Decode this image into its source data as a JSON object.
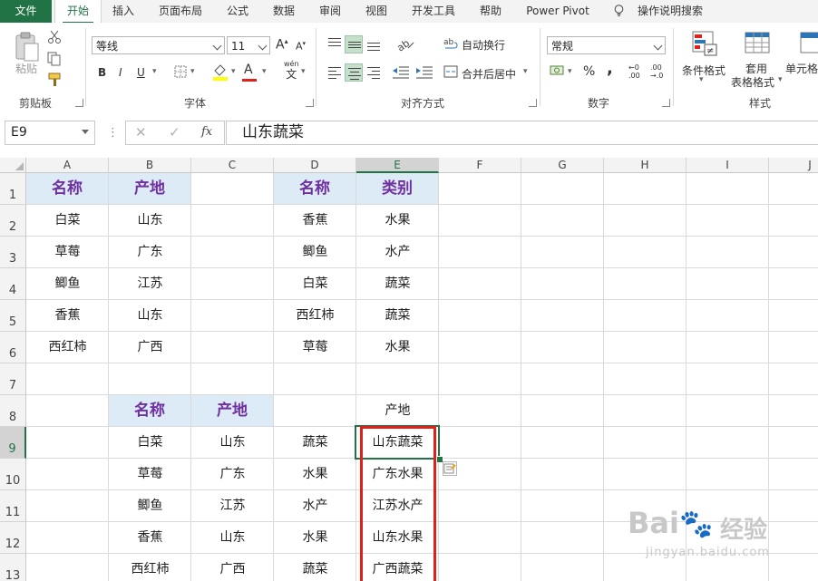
{
  "ribbon_tabs": [
    "文件",
    "开始",
    "插入",
    "页面布局",
    "公式",
    "数据",
    "审阅",
    "视图",
    "开发工具",
    "帮助",
    "Power Pivot",
    "操作说明搜索"
  ],
  "clipboard": {
    "paste_label": "粘贴",
    "group_label": "剪贴板"
  },
  "font": {
    "name": "等线",
    "size": "11",
    "bold": "B",
    "italic": "I",
    "underline": "U",
    "wen": "wén",
    "wen_char": "文",
    "font_color_letter": "A",
    "grow": "A",
    "shrink": "A",
    "group_label": "字体"
  },
  "alignment": {
    "wrap_label": "自动换行",
    "merge_label": "合并后居中",
    "group_label": "对齐方式"
  },
  "number": {
    "format": "常规",
    "percent": "%",
    "comma": ",",
    "inc_top": "←0",
    "inc_bottom": ".00",
    "dec_top": ".00",
    "dec_bottom": "→.0",
    "group_label": "数字"
  },
  "styles": {
    "cond_format": "条件格式",
    "table_format_1": "套用",
    "table_format_2": "表格格式",
    "cell_styles": "单元格",
    "group_label": "样式"
  },
  "formula_bar": {
    "name_box": "E9",
    "fx": "fx",
    "cancel": "✕",
    "enter": "✓",
    "content": "山东蔬菜"
  },
  "columns": [
    "A",
    "B",
    "C",
    "D",
    "E",
    "F",
    "G",
    "H",
    "I",
    "J"
  ],
  "rows": [
    "1",
    "2",
    "3",
    "4",
    "5",
    "6",
    "7",
    "8",
    "9",
    "10",
    "11",
    "12",
    "13"
  ],
  "table1": {
    "headers": [
      "名称",
      "产地"
    ],
    "rows": [
      [
        "白菜",
        "山东"
      ],
      [
        "草莓",
        "广东"
      ],
      [
        "鲫鱼",
        "江苏"
      ],
      [
        "香蕉",
        "山东"
      ],
      [
        "西红柿",
        "广西"
      ]
    ]
  },
  "table2": {
    "headers": [
      "名称",
      "类别"
    ],
    "rows": [
      [
        "香蕉",
        "水果"
      ],
      [
        "鲫鱼",
        "水产"
      ],
      [
        "白菜",
        "蔬菜"
      ],
      [
        "西红柿",
        "蔬菜"
      ],
      [
        "草莓",
        "水果"
      ]
    ]
  },
  "table3": {
    "headers": [
      "名称",
      "产地"
    ],
    "e8_label": "产地",
    "rows": [
      [
        "白菜",
        "山东",
        "蔬菜",
        "山东蔬菜"
      ],
      [
        "草莓",
        "广东",
        "水果",
        "广东水果"
      ],
      [
        "鲫鱼",
        "江苏",
        "水产",
        "江苏水产"
      ],
      [
        "香蕉",
        "山东",
        "水果",
        "山东水果"
      ],
      [
        "西红柿",
        "广西",
        "蔬菜",
        "广西蔬菜"
      ]
    ]
  },
  "colors": {
    "header_fill": "#ddebf7",
    "header_text": "#7030a0",
    "highlight_box": "#e0201b",
    "excel_green": "#217346"
  },
  "watermark": {
    "brand": "Bai",
    "brand_cn": "经验",
    "url": "jingyan.baidu.com"
  }
}
